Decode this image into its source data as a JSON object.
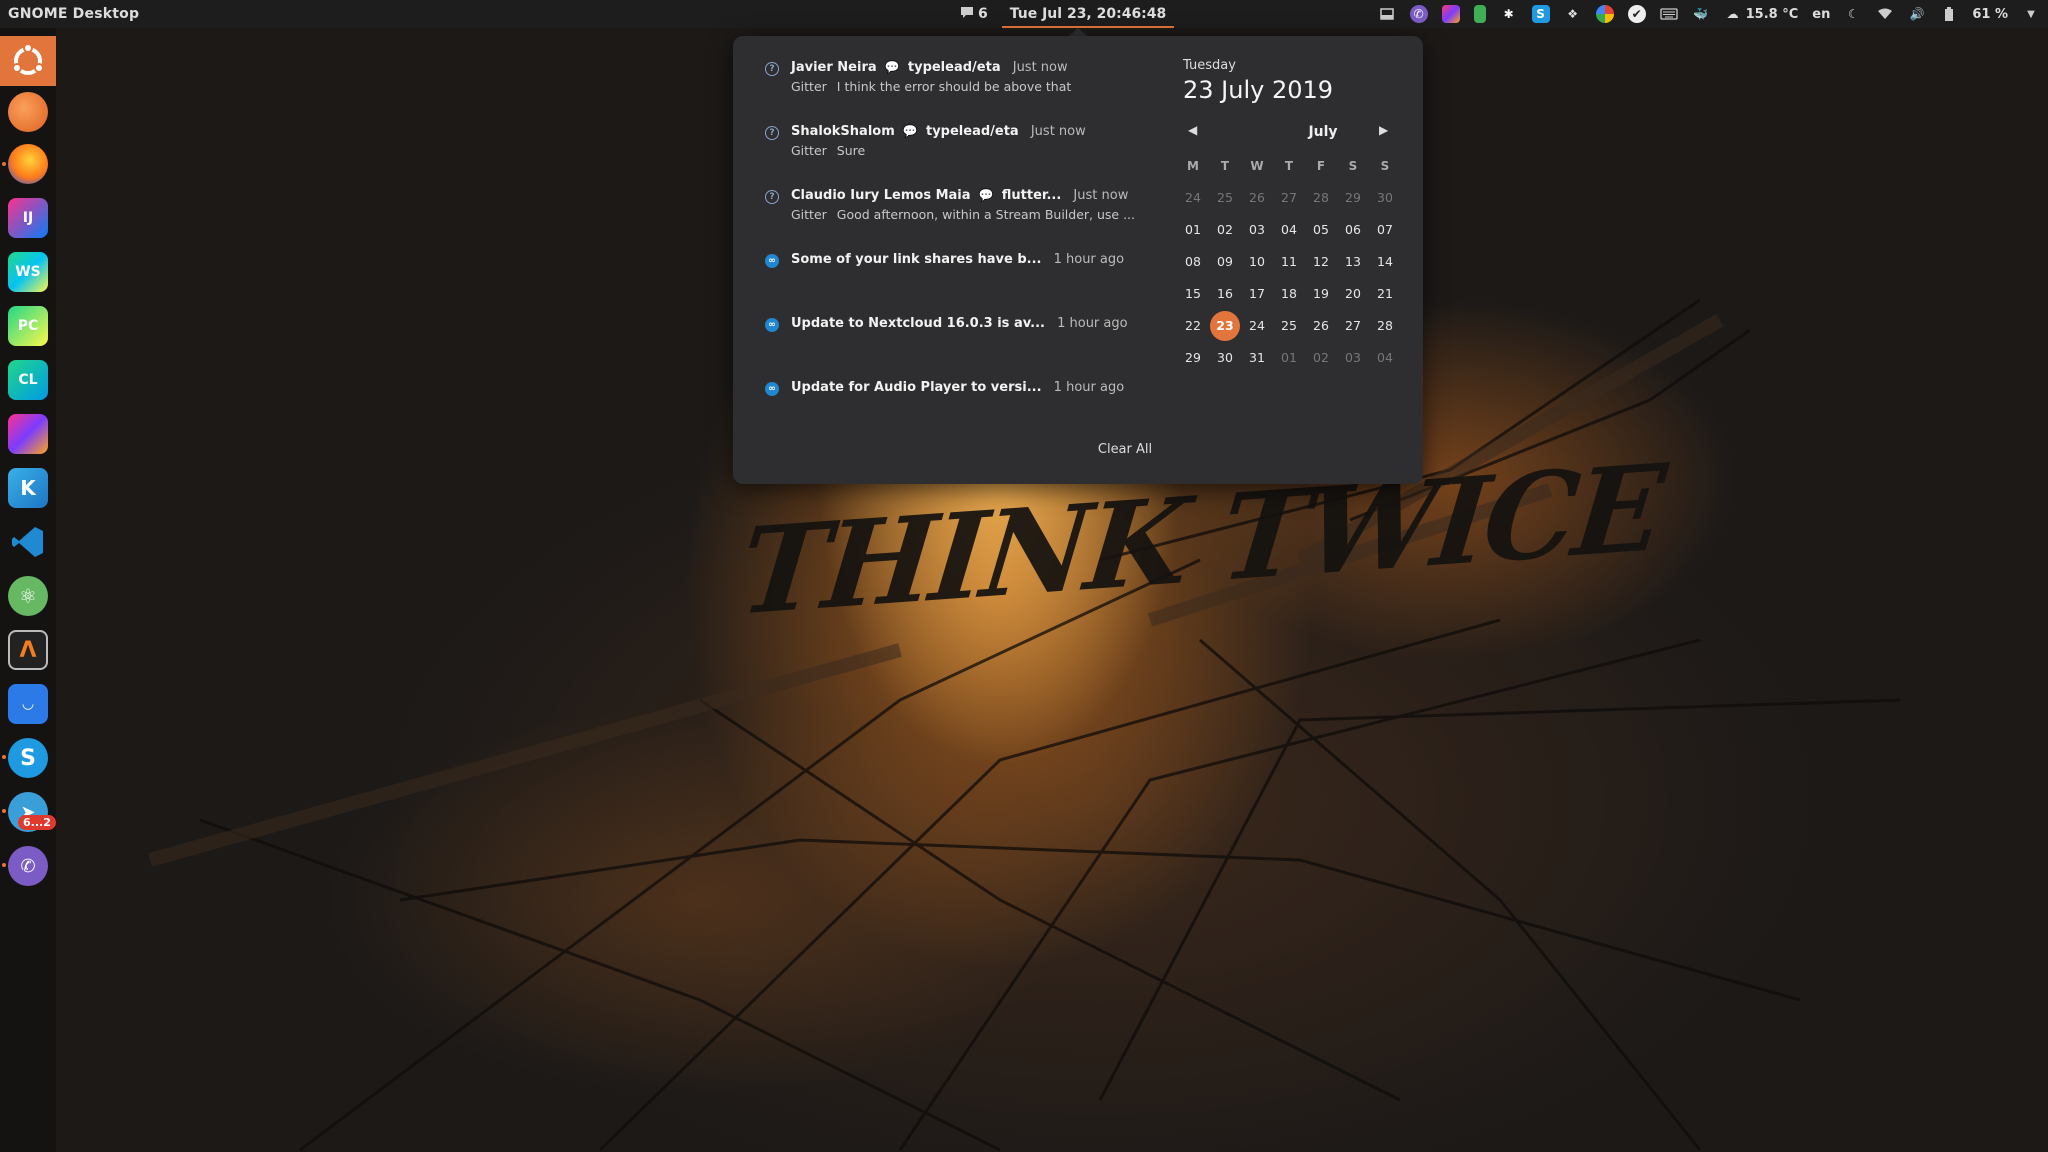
{
  "topbar": {
    "app_name": "GNOME Desktop",
    "notification_count": "6",
    "clock": "Tue Jul 23, 20:46:48",
    "weather": "15.8 °C",
    "keyboard_layout": "en",
    "battery": "61 %",
    "tray_icons": [
      "screen-icon",
      "viber-icon",
      "jetbrains-toolbox-icon",
      "phone-icon",
      "slack-icon",
      "skype-icon",
      "dropbox-icon",
      "google-icon",
      "check-icon",
      "keyboard-icon",
      "docker-icon",
      "weather-icon",
      "night-light-icon",
      "wifi-icon",
      "volume-icon",
      "battery-icon",
      "menu-arrow-icon"
    ]
  },
  "dock": {
    "apps": [
      "ubuntu",
      "ubuntu-software",
      "firefox",
      "intellij-idea",
      "webstorm",
      "pycharm",
      "clion",
      "jetbrains-toolbox",
      "kotlin",
      "vscode",
      "atom",
      "arduino",
      "app-store",
      "skype",
      "telegram",
      "viber"
    ],
    "telegram_badge": "6...2"
  },
  "notifications": [
    {
      "title": "Javier Neira",
      "room": "typelead/eta",
      "time": "Just now",
      "source": "Gitter",
      "body": "I think the error should be above that",
      "icon": "gitter-icon"
    },
    {
      "title": "ShalokShalom",
      "room": "typelead/eta",
      "time": "Just now",
      "source": "Gitter",
      "body": "Sure",
      "icon": "gitter-icon"
    },
    {
      "title": "Claudio Iury Lemos Maia",
      "room": "flutter...",
      "time": "Just now",
      "source": "Gitter",
      "body": "Good afternoon, within a Stream Builder, use ...",
      "icon": "gitter-icon"
    },
    {
      "title": "Some of your link shares have b...",
      "room": "",
      "time": "1 hour ago",
      "source": "",
      "body": "",
      "icon": "nextcloud-icon"
    },
    {
      "title": "Update to Nextcloud 16.0.3 is av...",
      "room": "",
      "time": "1 hour ago",
      "source": "",
      "body": "",
      "icon": "nextcloud-icon"
    },
    {
      "title": "Update for Audio Player to versi...",
      "room": "",
      "time": "1 hour ago",
      "source": "",
      "body": "",
      "icon": "nextcloud-icon"
    }
  ],
  "clear_all": "Clear All",
  "calendar": {
    "weekday": "Tuesday",
    "date": "23 July 2019",
    "month": "July",
    "day_headers": [
      "M",
      "T",
      "W",
      "T",
      "F",
      "S",
      "S"
    ],
    "weeks": [
      [
        "24",
        "25",
        "26",
        "27",
        "28",
        "29",
        "30"
      ],
      [
        "01",
        "02",
        "03",
        "04",
        "05",
        "06",
        "07"
      ],
      [
        "08",
        "09",
        "10",
        "11",
        "12",
        "13",
        "14"
      ],
      [
        "15",
        "16",
        "17",
        "18",
        "19",
        "20",
        "21"
      ],
      [
        "22",
        "23",
        "24",
        "25",
        "26",
        "27",
        "28"
      ],
      [
        "29",
        "30",
        "31",
        "01",
        "02",
        "03",
        "04"
      ]
    ],
    "today": "23"
  },
  "wallpaper": {
    "text": "THINK TWICE"
  },
  "colors": {
    "accent": "#e2753b",
    "panel": "#1d1d1d",
    "popup": "#2e2e31"
  }
}
